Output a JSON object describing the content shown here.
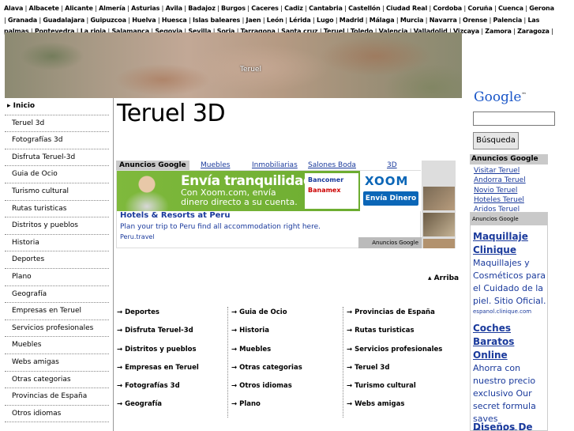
{
  "provinces": [
    "Alava",
    "Albacete",
    "Alicante",
    "Almería",
    "Asturias",
    "Avila",
    "Badajoz",
    "Burgos",
    "Caceres",
    "Cadiz",
    "Cantabria",
    "Castellón",
    "Ciudad Real",
    "Cordoba",
    "Coruña",
    "Cuenca",
    "Gerona",
    "Granada",
    "Guadalajara",
    "Guipuzcoa",
    "Huelva",
    "Huesca",
    "Islas baleares",
    "Jaen",
    "León",
    "Lérida",
    "Lugo",
    "Madrid",
    "Málaga",
    "Murcia",
    "Navarra",
    "Orense",
    "Palencia",
    "Las palmas",
    "Pontevedra",
    "La rioja",
    "Salamanca",
    "Segovia",
    "Sevilla",
    "Soria",
    "Tarragona",
    "Santa cruz",
    "Teruel",
    "Toledo",
    "Valencia",
    "Valladolid",
    "Vizcaya",
    "Zamora",
    "Zaragoza"
  ],
  "banner": {
    "label": "Teruel"
  },
  "nav": [
    "Inicio",
    "Teruel 3d",
    "Fotografías 3d",
    "Disfruta Teruel-3d",
    "Guia de Ocio",
    "Turismo cultural",
    "Rutas turisticas",
    "Distritos y pueblos",
    "Historia",
    "Deportes",
    "Plano",
    "Geografía",
    "Empresas en Teruel",
    "Servicios profesionales",
    "Muebles",
    "Webs amigas",
    "Otras categorias",
    "Provincias de España",
    "Otros idiomas"
  ],
  "page_title": "Teruel 3D",
  "ad_tabs": {
    "google": "Anuncios Google",
    "links": [
      "Muebles",
      "Inmobiliarias",
      "Salones Boda",
      "3D"
    ]
  },
  "xoom": {
    "headline": "Envía tranquilidad.",
    "body": "Con Xoom.com, envía dinero directo a su cuenta.",
    "bank1": "Bancomer",
    "bank2": "Banamex",
    "logo": "XOOM",
    "button": "Envía Dinero"
  },
  "text_ad": {
    "title": "Hotels & Resorts at Peru",
    "desc": "Plan your trip to Peru find all accommodation right here.",
    "url": "Peru.travel",
    "badge": "Anuncios Google"
  },
  "arriba": "Arriba",
  "bottom_cols": [
    [
      "Deportes",
      "Disfruta Teruel-3d",
      "Distritos y pueblos",
      "Empresas en Teruel",
      "Fotografías 3d",
      "Geografía"
    ],
    [
      "Guia de Ocio",
      "Historia",
      "Muebles",
      "Otras categorias",
      "Otros idiomas",
      "Plano"
    ],
    [
      "Provincias de España",
      "Rutas turisticas",
      "Servicios profesionales",
      "Teruel 3d",
      "Turismo cultural",
      "Webs amigas"
    ]
  ],
  "google": {
    "logo": "Google",
    "button": "Búsqueda",
    "search_value": ""
  },
  "right_ads": {
    "head": "Anuncios Google",
    "links": [
      "Visitar Teruel",
      "Andorra Teruel",
      "Novio Teruel",
      "Hoteles Teruel",
      "Aridos Teruel"
    ],
    "bar": "Anuncios Google"
  },
  "right_ads_list": [
    {
      "title": "Maquillaje Clinique",
      "body": "Maquillajes y Cosméticos para el Cuidado de la piel. Sitio Oficial.",
      "url": "espanol.clinique.com"
    },
    {
      "title": "Coches Baratos Online",
      "body": "Ahorra con nuestro precio exclusivo Our secret formula saves thousands!"
    },
    {
      "title": "Diseños De"
    }
  ]
}
